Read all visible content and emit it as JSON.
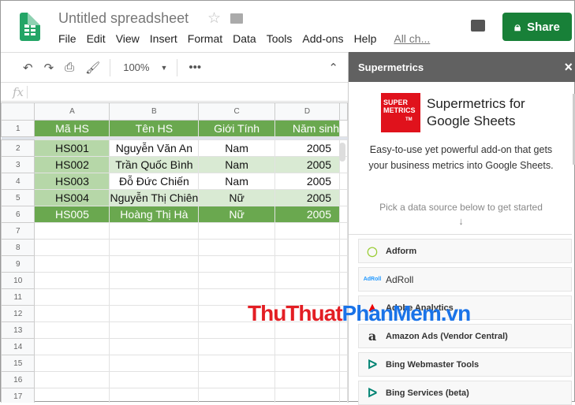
{
  "app": {
    "title": "Untitled spreadsheet",
    "share_label": "Share",
    "menu": [
      "File",
      "Edit",
      "View",
      "Insert",
      "Format",
      "Data",
      "Tools",
      "Add-ons",
      "Help"
    ],
    "all_changes": "All ch...",
    "zoom": "100%",
    "fx": "fx"
  },
  "grid": {
    "columns": [
      "A",
      "B",
      "C",
      "D"
    ],
    "header": [
      "Mã HS",
      "Tên HS",
      "Giới Tính",
      "Năm sinh"
    ],
    "rows": [
      [
        "HS001",
        "Nguyễn Văn An",
        "Nam",
        "2005"
      ],
      [
        "HS002",
        "Trần Quốc Bình",
        "Nam",
        "2005"
      ],
      [
        "HS003",
        "Đỗ Đức Chiến",
        "Nam",
        "2005"
      ],
      [
        "HS004",
        "Nguyễn Thị Chiên",
        "Nữ",
        "2005"
      ],
      [
        "HS005",
        "Hoàng Thị Hà",
        "Nữ",
        "2005"
      ]
    ],
    "row_numbers": [
      "1",
      "2",
      "3",
      "4",
      "5",
      "6",
      "7",
      "8",
      "9",
      "10",
      "11",
      "12",
      "13",
      "14",
      "15",
      "16",
      "17"
    ]
  },
  "panel": {
    "title": "Supermetrics",
    "close": "×",
    "logo_text": "SUPER METRICS",
    "heading": "Supermetrics for Google Sheets",
    "description": "Easy-to-use yet powerful add-on that gets your business metrics into Google Sheets.",
    "pick": "Pick a data source below to get started",
    "arrow": "↓",
    "sources": [
      "Adform",
      "AdRoll",
      "Adobe Analytics",
      "Amazon Ads (Vendor Central)",
      "Bing Webmaster Tools",
      "Bing Services (beta)"
    ]
  },
  "watermark": "ThuThuatPhanMem.vn",
  "colors": {
    "header_green": "#6aa84f",
    "light_green": "#b6d7a8",
    "alt_green": "#d9ead3",
    "share": "#188038"
  }
}
